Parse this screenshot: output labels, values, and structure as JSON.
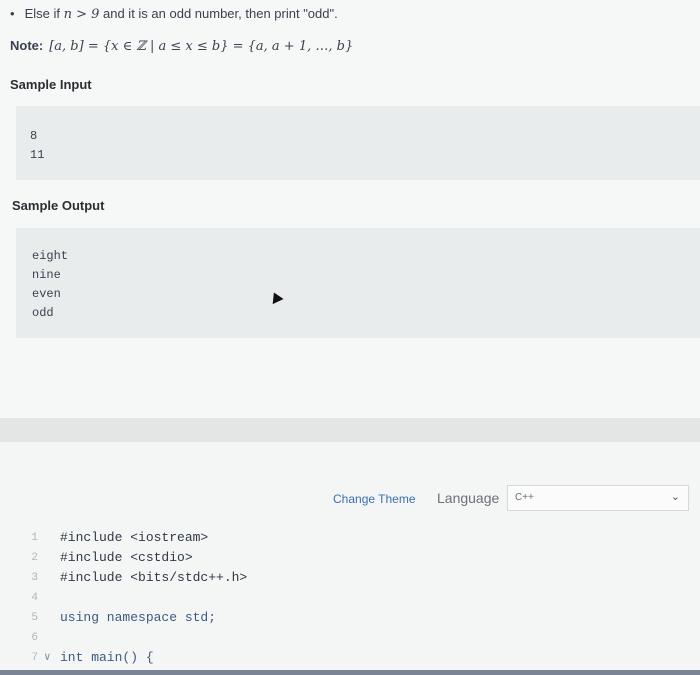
{
  "problem": {
    "bullet": "•",
    "else_prefix": "Else if ",
    "else_math": "n > 9",
    "else_suffix": " and it is an odd number, then print \"odd\".",
    "note_label": "Note:",
    "note_math": "[a, b] = {x ∈ ℤ | a ≤ x ≤ b} = {a, a + 1, …, b}"
  },
  "sample_input": {
    "title": "Sample Input",
    "lines": [
      "8",
      "11"
    ]
  },
  "sample_output": {
    "title": "Sample Output",
    "lines": [
      "eight",
      "nine",
      "even",
      "odd"
    ]
  },
  "toolbar": {
    "change_theme": "Change Theme",
    "language_label": "Language",
    "language_value": "C++",
    "chevron_icon": "chevron-down-icon"
  },
  "editor": {
    "lines": [
      {
        "num": "1",
        "text": "#include <iostream>"
      },
      {
        "num": "2",
        "text": "#include <cstdio>"
      },
      {
        "num": "3",
        "text": "#include <bits/stdc++.h>"
      },
      {
        "num": "4",
        "text": ""
      },
      {
        "num": "5",
        "text": "using namespace std;"
      },
      {
        "num": "6",
        "text": ""
      },
      {
        "num": "7",
        "text": "int main() {"
      }
    ]
  }
}
